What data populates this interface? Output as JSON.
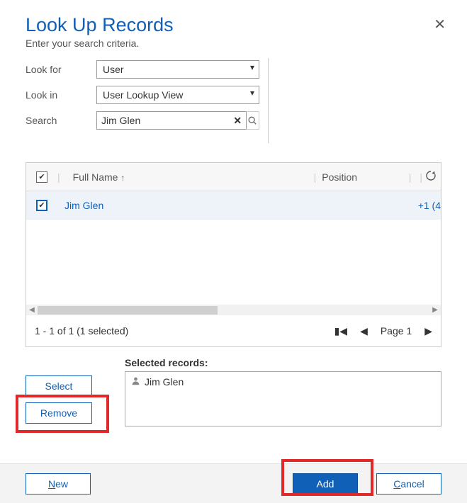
{
  "title": "Look Up Records",
  "subtitle": "Enter your search criteria.",
  "close_glyph": "✕",
  "criteria": {
    "look_for_label": "Look for",
    "look_for_value": "User",
    "look_in_label": "Look in",
    "look_in_value": "User Lookup View",
    "search_label": "Search",
    "search_value": "Jim Glen",
    "clear_glyph": "✕"
  },
  "grid": {
    "columns": {
      "full_name": "Full Name",
      "position": "Position"
    },
    "sort_indicator": "↑",
    "rows": [
      {
        "name": "Jim Glen",
        "phone_trunc": "+1 (4"
      }
    ],
    "status": "1 - 1 of 1 (1 selected)",
    "page_label": "Page 1"
  },
  "selected": {
    "title": "Selected records:",
    "items": [
      "Jim Glen"
    ]
  },
  "buttons": {
    "select": "Select",
    "remove": "Remove",
    "new_prefix": "N",
    "new_rest": "ew",
    "add": "Add",
    "cancel_prefix": "C",
    "cancel_rest": "ancel"
  }
}
